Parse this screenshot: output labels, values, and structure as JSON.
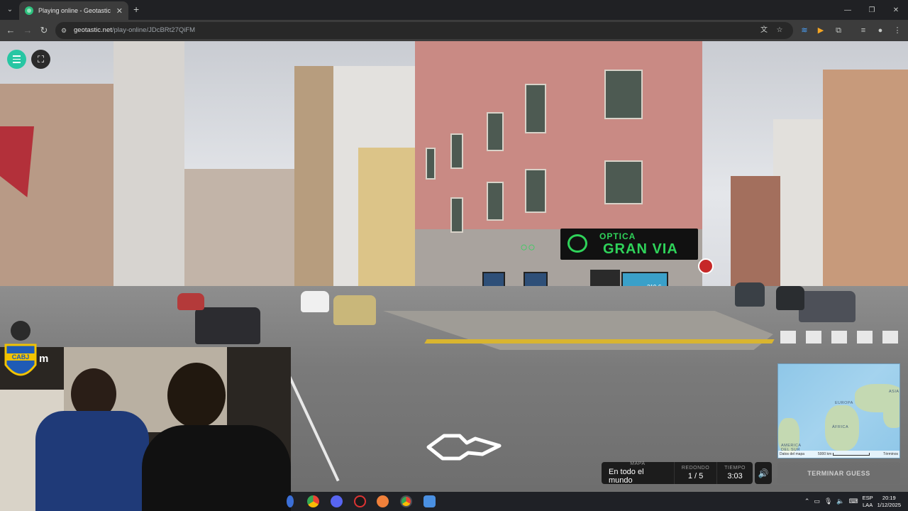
{
  "browser": {
    "tab_title": "Playing online - Geotastic",
    "url_host": "geotastic.net",
    "url_path": "/play-online/JDcBRt27QiFM"
  },
  "scene": {
    "shop_sign_line1": "OPTICA",
    "shop_sign_line2": "GRAN VIA",
    "price_tag": "319 €"
  },
  "game": {
    "map_label": "MAPA",
    "map_value": "En todo el mundo",
    "round_label": "REDONDO",
    "round_value": "1 / 5",
    "time_label": "TIEMPO",
    "time_value": "3:03",
    "guess_button": "TERMINAR GUESS"
  },
  "minimap": {
    "labels": [
      "EUROPA",
      "ÁFRICA",
      "ASIA",
      "AMERICA\nDEL SUR"
    ],
    "footer_left": "Datos del mapa",
    "scale": "5000 km",
    "terms": "Términos"
  },
  "overlay": {
    "badge_text": "CABJ",
    "channel_suffix": "m"
  },
  "taskbar": {
    "lang_top": "ESP",
    "lang_bottom": "LAA",
    "time": "20:19",
    "date": "1/12/2025"
  },
  "colors": {
    "accent": "#27c6a3",
    "shop_green": "#2fd35a",
    "building_pink": "#c98a84",
    "curb_yellow": "#d9b530"
  }
}
